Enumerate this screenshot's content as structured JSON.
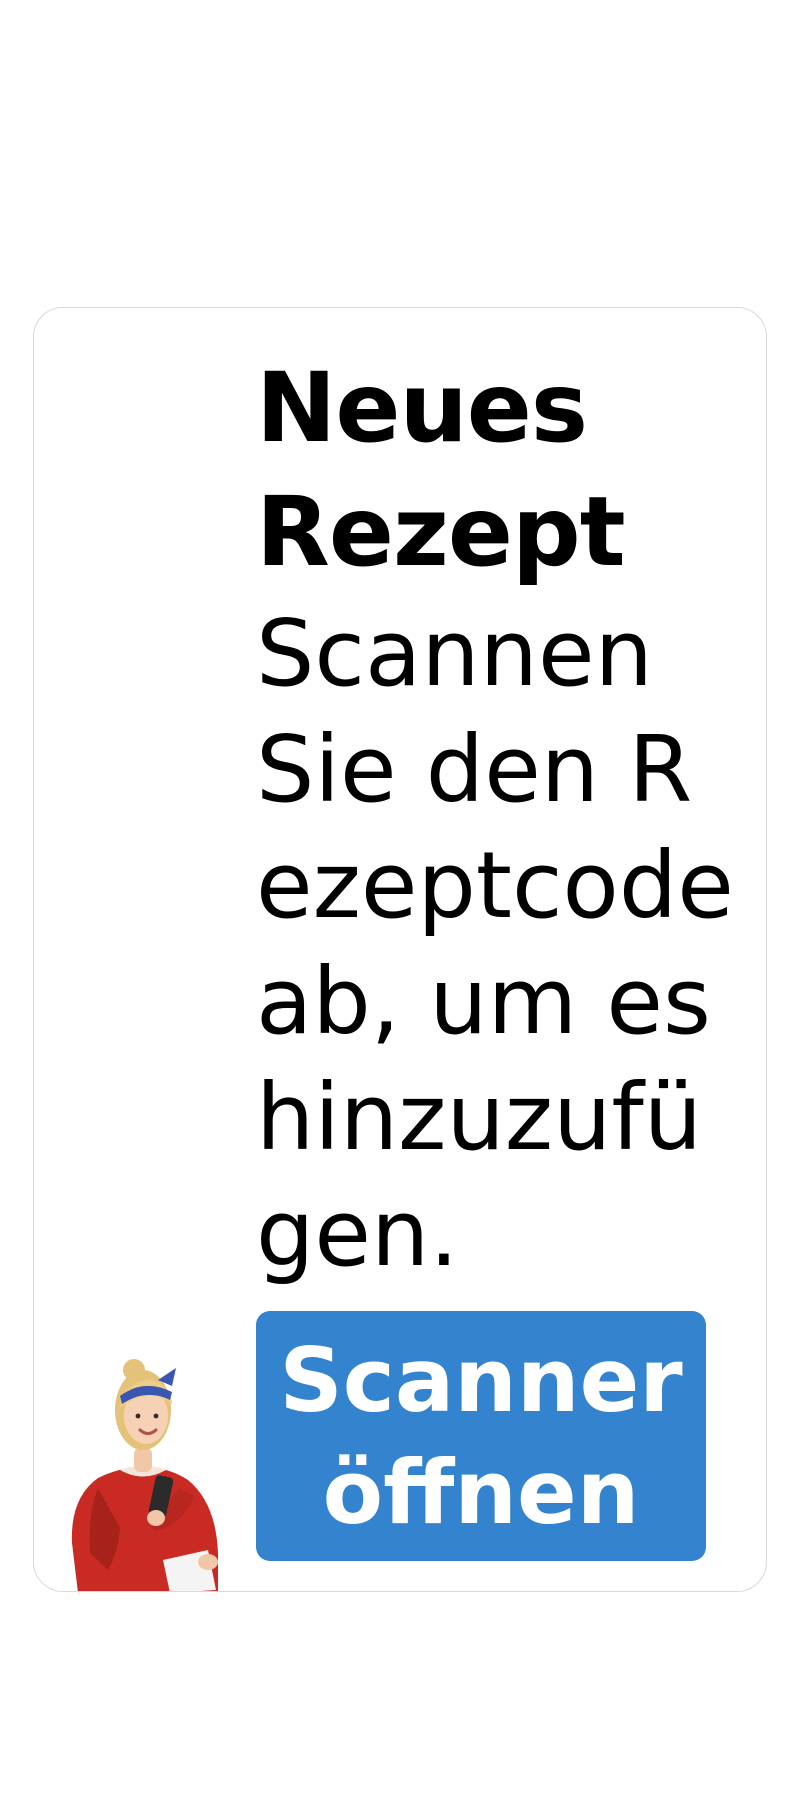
{
  "card": {
    "title": "Neues Rezept",
    "description": "Scannen Sie den Rezeptcode ab, um es hinzuzufügen.",
    "button_label": "Scanner öffnen"
  },
  "colors": {
    "button_background": "#3483cf",
    "button_text": "#ffffff",
    "card_border": "#d9d9d9"
  },
  "illustration": {
    "icon": "woman-holding-phone-illustration"
  }
}
